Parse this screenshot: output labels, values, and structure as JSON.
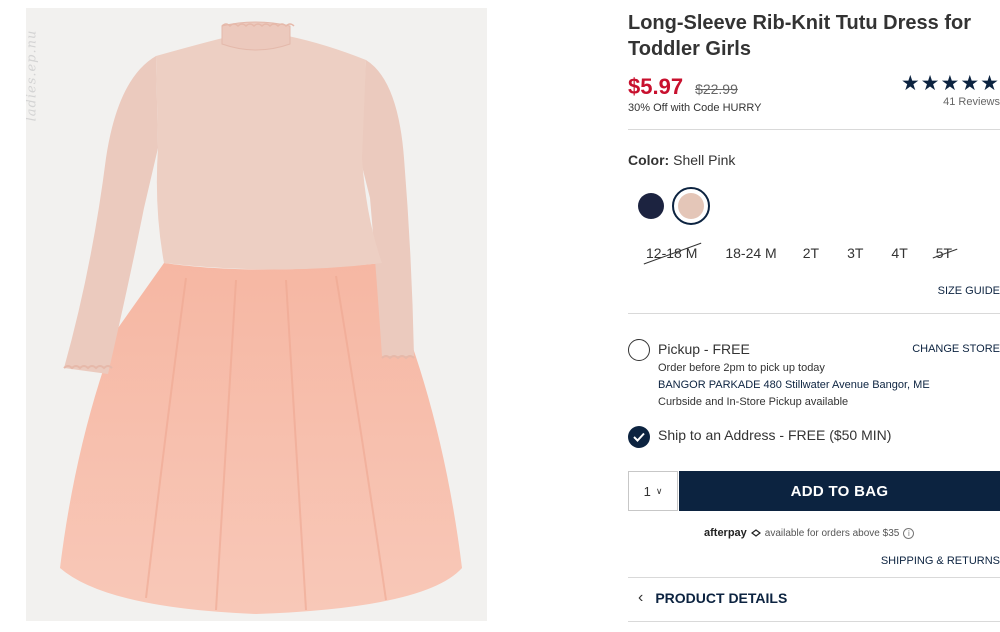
{
  "watermark": "ladies.ep.nu",
  "product": {
    "title": "Long-Sleeve Rib-Knit Tutu Dress for Toddler Girls",
    "sale_price": "$5.97",
    "original_price": "$22.99",
    "promo": "30% Off with Code HURRY",
    "stars": "★★★★★",
    "review_count": "41 Reviews"
  },
  "color": {
    "label": "Color:",
    "value": "Shell Pink",
    "swatches": [
      {
        "name": "navy",
        "hex": "#1c2340"
      },
      {
        "name": "shell-pink",
        "hex": "#e4c6b8",
        "selected": true
      }
    ]
  },
  "sizes": [
    {
      "label": "12-18 M",
      "available": false
    },
    {
      "label": "18-24 M",
      "available": true
    },
    {
      "label": "2T",
      "available": true
    },
    {
      "label": "3T",
      "available": true
    },
    {
      "label": "4T",
      "available": true
    },
    {
      "label": "5T",
      "available": false
    }
  ],
  "size_guide": "SIZE GUIDE",
  "fulfillment": {
    "pickup_label": "Pickup - FREE",
    "change_store": "CHANGE STORE",
    "pickup_note": "Order before 2pm to pick up today",
    "store": "BANGOR PARKADE 480 Stillwater Avenue  Bangor, ME",
    "curbside": "Curbside and In-Store Pickup available",
    "ship_label": "Ship to an Address - FREE ($50 MIN)"
  },
  "cart": {
    "quantity": "1",
    "add_to_bag": "ADD TO BAG"
  },
  "afterpay": {
    "logo": "afterpay",
    "text": "available for orders above $35"
  },
  "shipping_returns": "SHIPPING & RETURNS",
  "product_details": "PRODUCT DETAILS",
  "colors": {
    "brand_navy": "#0c2340",
    "sale_red": "#c8102e"
  }
}
